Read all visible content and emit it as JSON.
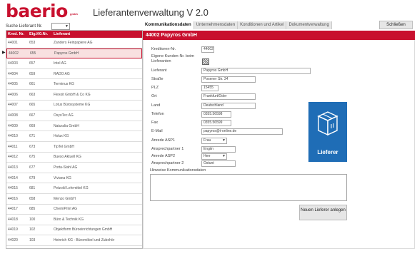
{
  "header": {
    "logo": "baerio",
    "logo_sup": "gmbh",
    "title": "Lieferantenverwaltung V 2.0"
  },
  "search": {
    "label": "Suche Lieferant Nr."
  },
  "list": {
    "columns": [
      "Kred. Nr.",
      "Eig.K0.Nr.",
      "Lieferant"
    ],
    "rows": [
      {
        "nr": "44001",
        "eig": "653",
        "name": "Zanders Feinpapiere AG"
      },
      {
        "nr": "44002",
        "eig": "655",
        "name": "Papyros GmbH"
      },
      {
        "nr": "44003",
        "eig": "657",
        "name": "Intel AG"
      },
      {
        "nr": "44004",
        "eig": "659",
        "name": "RADO AG"
      },
      {
        "nr": "44005",
        "eig": "661",
        "name": "Terminus KG"
      },
      {
        "nr": "44006",
        "eig": "663",
        "name": "Flexoit GmbH & Co KG"
      },
      {
        "nr": "44007",
        "eig": "665",
        "name": "Lotus Bürosysteme KG"
      },
      {
        "nr": "44008",
        "eig": "667",
        "name": "OsyoTec AG"
      },
      {
        "nr": "44009",
        "eig": "669",
        "name": "Naturalia GmbH"
      },
      {
        "nr": "44010",
        "eig": "671",
        "name": "Holux KG"
      },
      {
        "nr": "44011",
        "eig": "673",
        "name": "TipTel GmbH"
      },
      {
        "nr": "44012",
        "eig": "675",
        "name": "Bueso Aktuell KG"
      },
      {
        "nr": "44013",
        "eig": "677",
        "name": "Porta-Stahl AG"
      },
      {
        "nr": "44014",
        "eig": "679",
        "name": "Viviana KG"
      },
      {
        "nr": "44015",
        "eig": "681",
        "name": "Petzold Lehrmittel KG"
      },
      {
        "nr": "44016",
        "eig": "658",
        "name": "Menzo GmbH"
      },
      {
        "nr": "44017",
        "eig": "685",
        "name": "ChemiPrint AG"
      },
      {
        "nr": "44018",
        "eig": "100",
        "name": "Büro & Technik KG"
      },
      {
        "nr": "44019",
        "eig": "102",
        "name": "Objektform Büroeinrichtungen GmbH"
      },
      {
        "nr": "44020",
        "eig": "103",
        "name": "Heinrich KG - Büromöbel und Zubehör"
      },
      {
        "nr": "44021",
        "eig": "9906-4",
        "name": "Vario Möbel KG"
      }
    ]
  },
  "tabs": [
    "Kommunikationsdaten",
    "Unternehmensdaten",
    "Konditionen und Artikel",
    "Dokumentverwaltung"
  ],
  "close_label": "Schließen",
  "detail": {
    "header": "44002  Papyros GmbH",
    "kreditor_label": "Kreditoren-Nr.",
    "kreditor_value": "44002",
    "eigene_label": "Eigene Kunden-Nr. beim Lieferanten",
    "lieferant_label": "Lieferant",
    "lieferant_value": "Papyros GmbH",
    "strasse_label": "Straße",
    "strasse_value": "Posener Str. 34",
    "plz_label": "PLZ",
    "plz_value": "15455",
    "ort_label": "Ort",
    "ort_value": "Frankfurt/Oder",
    "land_label": "Land",
    "land_value": "Deutschland",
    "telefon_label": "Telefon",
    "telefon_value": "0355.56598",
    "fax_label": "Fax",
    "fax_value": "0355.56599",
    "email_label": "E-Mail",
    "email_value": "papyros@t-online.de",
    "anrede1_label": "Anrede ASP1",
    "anrede1_value": "Frau",
    "ansprech1_label": "Ansprechpartner 1",
    "ansprech1_value": "Engiin",
    "anrede2_label": "Anrede ASP2",
    "anrede2_value": "Herr",
    "ansprech2_label": "Ansprechpartner 2",
    "ansprech2_value": "Ostunt",
    "notes_label": "Hinweise Kommunikationsdaten",
    "badge_label": "Lieferer",
    "new_button": "Neuen Lieferer anlegen"
  },
  "colors": {
    "brand": "#c8102e",
    "badge": "#1f6db6"
  }
}
